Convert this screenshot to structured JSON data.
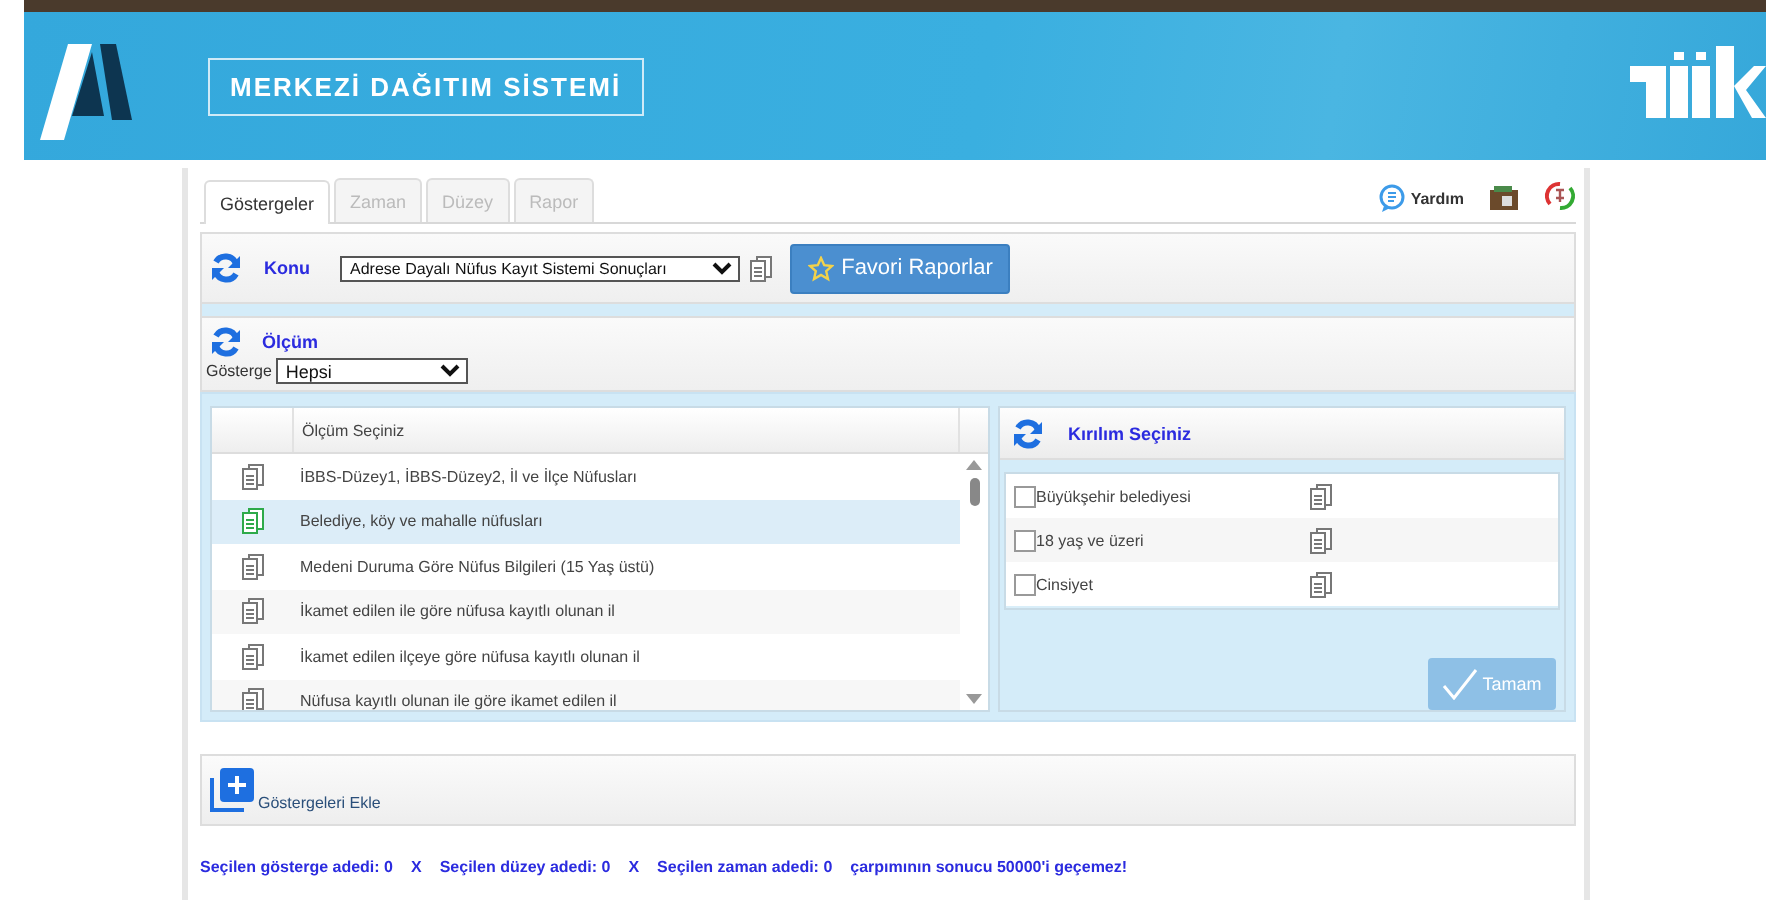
{
  "header": {
    "title": "MERKEZİ DAĞITIM SİSTEMİ"
  },
  "tabs": [
    {
      "label": "Göstergeler",
      "selected": true
    },
    {
      "label": "Zaman",
      "selected": false
    },
    {
      "label": "Düzey",
      "selected": false
    },
    {
      "label": "Rapor",
      "selected": false
    }
  ],
  "help": {
    "label": "Yardım"
  },
  "konu": {
    "label": "Konu",
    "value": "Adrese Dayalı Nüfus Kayıt Sistemi Sonuçları",
    "button": "Favori Raporlar"
  },
  "olcum": {
    "label": "Ölçüm",
    "filter_label": "Gösterge",
    "filter_value": "Hepsi"
  },
  "measures": {
    "column": "Ölçüm Seçiniz",
    "rows": [
      {
        "label": "İBBS-Düzey1, İBBS-Düzey2, İl ve İlçe Nüfusları",
        "selected": false
      },
      {
        "label": "Belediye, köy ve mahalle nüfusları",
        "selected": true
      },
      {
        "label": "Medeni Duruma Göre Nüfus Bilgileri (15 Yaş üstü)",
        "selected": false
      },
      {
        "label": "İkamet edilen ile göre nüfusa kayıtlı olunan il",
        "selected": false
      },
      {
        "label": "İkamet edilen ilçeye göre nüfusa kayıtlı olunan il",
        "selected": false
      },
      {
        "label": "Nüfusa kayıtlı olunan ile göre ikamet edilen il",
        "selected": false
      }
    ]
  },
  "breakdown": {
    "title": "Kırılım Seçiniz",
    "items": [
      {
        "label": "Büyükşehir belediyesi",
        "checked": false
      },
      {
        "label": "18 yaş ve üzeri",
        "checked": false
      },
      {
        "label": "Cinsiyet",
        "checked": false
      }
    ],
    "button": "Tamam",
    "button_disabled": true
  },
  "add": {
    "label": "Göstergeleri Ekle"
  },
  "footer": [
    {
      "text": "Seçilen gösterge adedi: 0"
    },
    {
      "text": "X"
    },
    {
      "text": "Seçilen düzey adedi: 0"
    },
    {
      "text": "X"
    },
    {
      "text": "Seçilen zaman adedi: 0"
    },
    {
      "text": "çarpımının sonucu 50000'i geçemez!"
    }
  ]
}
